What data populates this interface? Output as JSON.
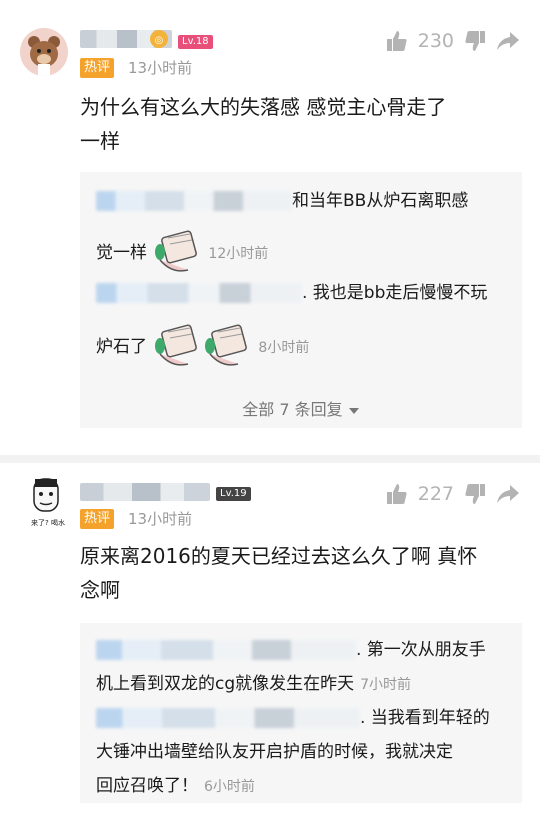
{
  "comments": [
    {
      "level": "Lv.18",
      "badge": "热评",
      "time": "13小时前",
      "likes": "230",
      "text_line1": "为什么有这么大的失落感   感觉主心骨走了",
      "text_line2": "一样",
      "replies": [
        {
          "line1": "和当年BB从炉石离职感",
          "line2": "觉一样",
          "time": "12小时前"
        },
        {
          "line1": ". 我也是bb走后慢慢不玩",
          "line2": "炉石了",
          "time": "8小时前"
        }
      ],
      "expand_label": "全部 7 条回复"
    },
    {
      "level": "Lv.19",
      "badge": "热评",
      "time": "13小时前",
      "likes": "227",
      "avatar_caption": "来了? 喝水",
      "text_line1": "原来离2016的夏天已经过去这么久了啊 真怀",
      "text_line2": "念啊",
      "replies": [
        {
          "line1": ". 第一次从朋友手",
          "line2": "机上看到双龙的cg就像发生在昨天",
          "time": "7小时前"
        },
        {
          "line1": ". 当我看到年轻的",
          "line2": "大锤冲出墙壁给队友开启护盾的时候，我就决定",
          "line3": "回应召唤了！",
          "time": "6小时前"
        }
      ]
    }
  ]
}
